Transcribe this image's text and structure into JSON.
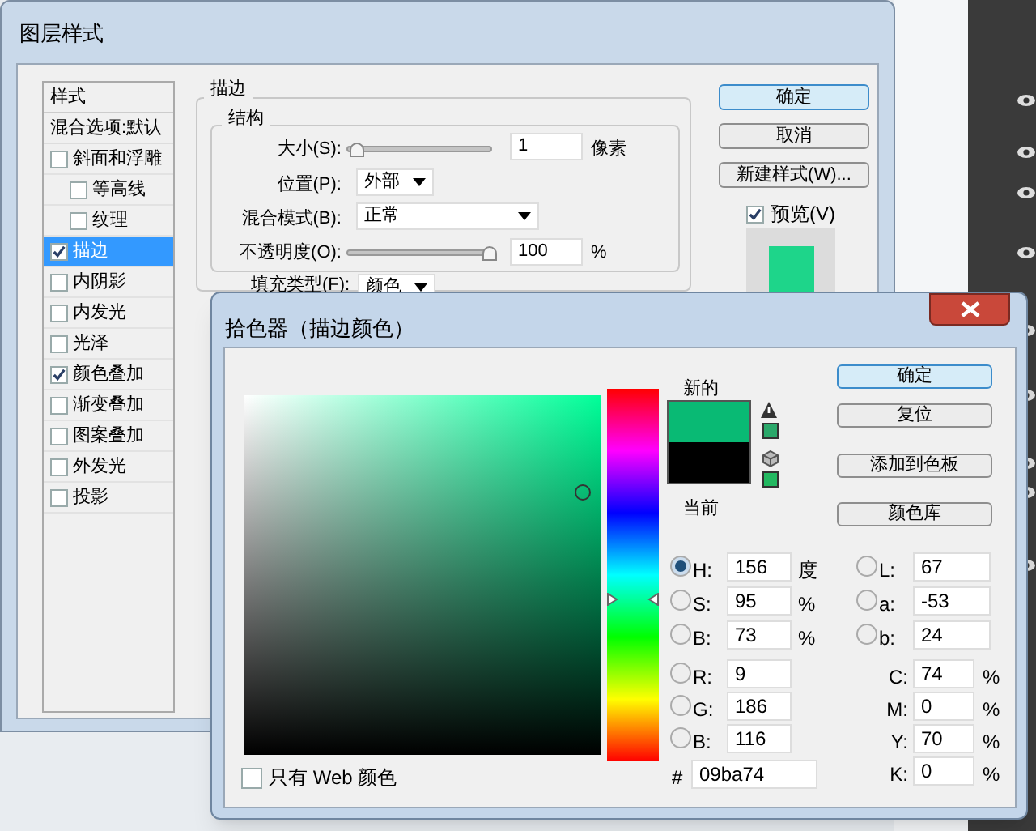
{
  "layer_style_dialog": {
    "title": "图层样式",
    "styles_header": "样式",
    "blending_options": "混合选项:默认",
    "styles": [
      {
        "label": "斜面和浮雕",
        "checked": false,
        "selected": false,
        "children": [
          {
            "label": "等高线",
            "checked": false,
            "selected": false
          },
          {
            "label": "纹理",
            "checked": false,
            "selected": false
          }
        ]
      },
      {
        "label": "描边",
        "checked": true,
        "selected": true
      },
      {
        "label": "内阴影",
        "checked": false,
        "selected": false
      },
      {
        "label": "内发光",
        "checked": false,
        "selected": false
      },
      {
        "label": "光泽",
        "checked": false,
        "selected": false
      },
      {
        "label": "颜色叠加",
        "checked": true,
        "selected": false
      },
      {
        "label": "渐变叠加",
        "checked": false,
        "selected": false
      },
      {
        "label": "图案叠加",
        "checked": false,
        "selected": false
      },
      {
        "label": "外发光",
        "checked": false,
        "selected": false
      },
      {
        "label": "投影",
        "checked": false,
        "selected": false
      }
    ],
    "stroke": {
      "title": "描边",
      "structure_title": "结构",
      "size": {
        "label": "大小(S):",
        "level": 0.02,
        "value": "1",
        "unit": "像素"
      },
      "position": {
        "label": "位置(P):",
        "value": "外部"
      },
      "blend_mode": {
        "label": "混合模式(B):",
        "value": "正常"
      },
      "opacity": {
        "label": "不透明度(O):",
        "level": 1,
        "value": "100",
        "unit": "%"
      },
      "fill_type": {
        "label": "填充类型(F):",
        "value": "颜色"
      }
    },
    "buttons": [
      {
        "label": "确定",
        "default": true
      },
      {
        "label": "取消",
        "default": false
      },
      {
        "label": "新建样式(W)...",
        "default": false
      }
    ],
    "preview": {
      "label": "预览(V)",
      "checked": true
    }
  },
  "color_picker": {
    "title": "拾色器（描边颜色）",
    "hue_slider": {
      "level": 0.433
    },
    "new_label": "新的",
    "current_label": "当前",
    "buttons": [
      {
        "label": "确定",
        "default": true
      },
      {
        "label": "复位",
        "default": false
      },
      {
        "label": "添加到色板",
        "default": false
      },
      {
        "label": "颜色库",
        "default": false
      }
    ],
    "hsb": [
      {
        "label": "H:",
        "value": "156",
        "unit": "度",
        "selected": true
      },
      {
        "label": "S:",
        "value": "95",
        "unit": "%",
        "selected": false
      },
      {
        "label": "B:",
        "value": "73",
        "unit": "%",
        "selected": false
      }
    ],
    "rgb": [
      {
        "label": "R:",
        "value": "9",
        "selected": false
      },
      {
        "label": "G:",
        "value": "186",
        "selected": false
      },
      {
        "label": "B:",
        "value": "116",
        "selected": false
      }
    ],
    "lab": [
      {
        "label": "L:",
        "value": "67",
        "selected": false
      },
      {
        "label": "a:",
        "value": "-53",
        "selected": false
      },
      {
        "label": "b:",
        "value": "24",
        "selected": false
      }
    ],
    "cmyk": [
      {
        "label": "C:",
        "value": "74",
        "unit": "%"
      },
      {
        "label": "M:",
        "value": "0",
        "unit": "%"
      },
      {
        "label": "Y:",
        "value": "70",
        "unit": "%"
      },
      {
        "label": "K:",
        "value": "0",
        "unit": "%"
      }
    ],
    "hex_label": "#",
    "hex": "09ba74",
    "web_only": {
      "label": "只有 Web 颜色",
      "checked": false
    }
  }
}
